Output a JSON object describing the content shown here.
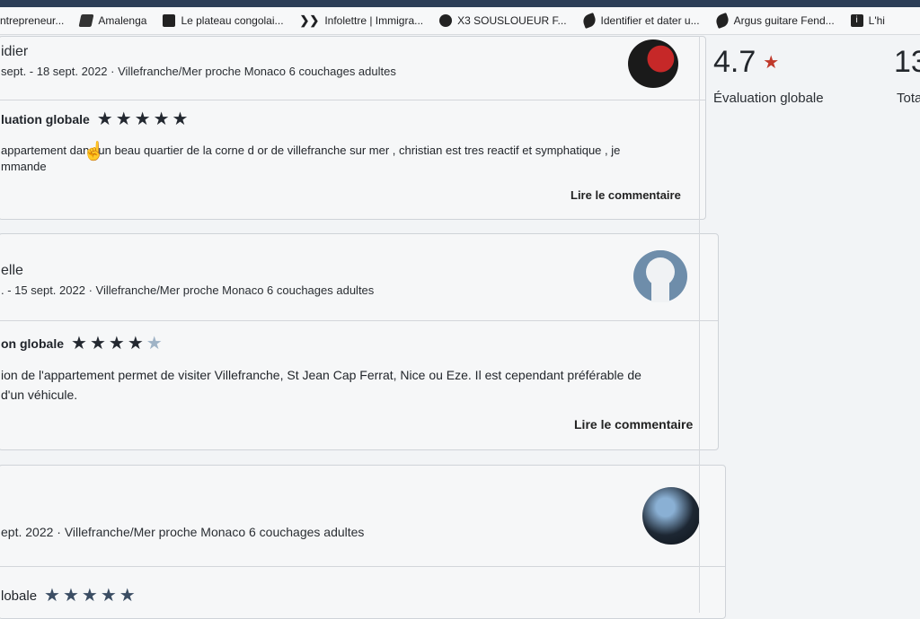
{
  "bookmarks": [
    {
      "label": "ntrepreneur...",
      "icon": "none"
    },
    {
      "label": "Amalenga",
      "icon": "folder-icon"
    },
    {
      "label": "Le plateau congolai...",
      "icon": "square-icon"
    },
    {
      "label": "Infolettre | Immigra...",
      "icon": "chevron-icon"
    },
    {
      "label": "X3 SOUSLOUEUR F...",
      "icon": "round-icon"
    },
    {
      "label": "Identifier et dater u...",
      "icon": "leaf-icon"
    },
    {
      "label": "Argus guitare Fend...",
      "icon": "leaf-icon"
    },
    {
      "label": "L'hi",
      "icon": "info-icon"
    }
  ],
  "summary": {
    "score": "4.7",
    "score_label": "Évaluation globale",
    "total_value": "13",
    "total_label": "Tota"
  },
  "reviews": [
    {
      "name": "idier",
      "meta": "sept. - 18 sept. 2022 · Villefranche/Mer proche Monaco 6 couchages adultes",
      "rating_label": "luation globale",
      "stars": 5,
      "comment_line1": "appartement dans un beau quartier de la corne d or de villefranche sur mer , christian est tres reactif et symphatique , je",
      "comment_line2": "mmande",
      "read_more": "Lire le commentaire"
    },
    {
      "name": "elle",
      "meta": ". - 15 sept. 2022 · Villefranche/Mer proche Monaco 6 couchages adultes",
      "rating_label": "on globale",
      "stars": 4,
      "comment_line1": "ion de l'appartement permet de visiter Villefranche, St Jean Cap Ferrat, Nice ou Eze. Il est cependant préférable de",
      "comment_line2": "d'un véhicule.",
      "read_more": "Lire le commentaire"
    },
    {
      "name": "",
      "meta": "ept. 2022 · Villefranche/Mer proche Monaco 6 couchages adultes",
      "rating_label": "lobale",
      "stars": 5
    }
  ],
  "colors": {
    "accent_star": "#c0392b",
    "star": "#232830",
    "star_dim": "#9fb3c6"
  }
}
